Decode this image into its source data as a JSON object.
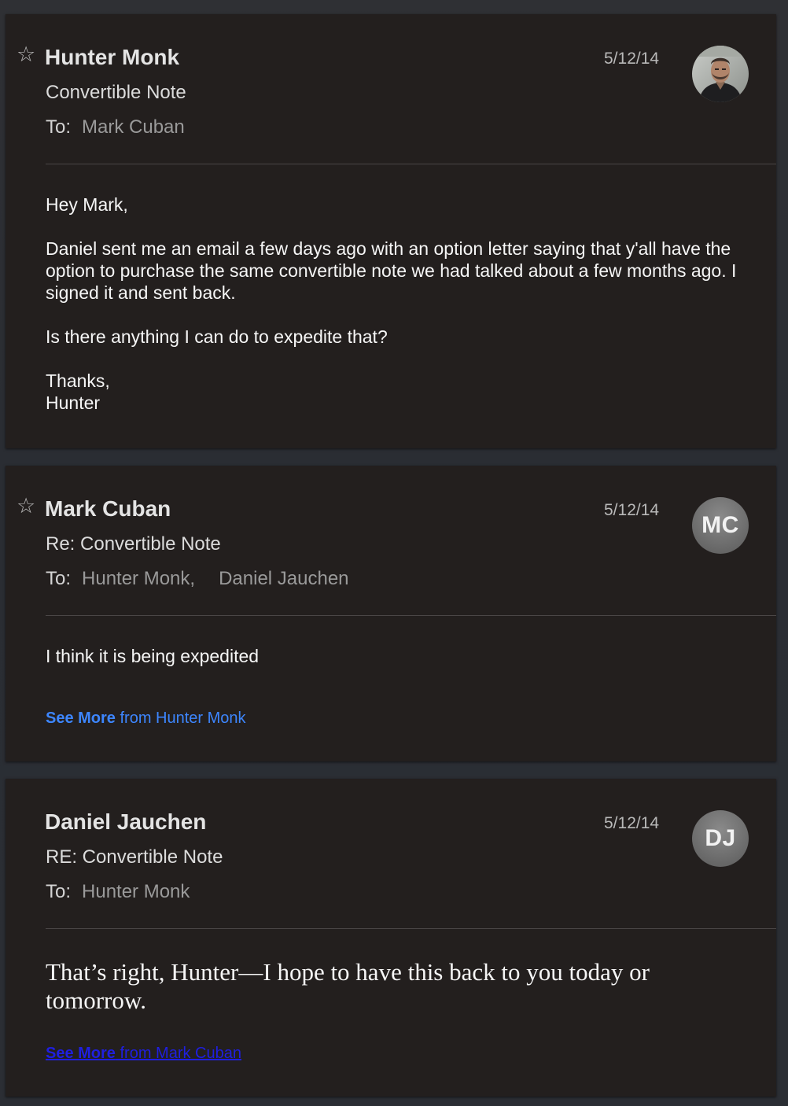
{
  "emails": [
    {
      "starred_icon": "star-outline-icon",
      "sender": "Hunter Monk",
      "date": "5/12/14",
      "subject": "Convertible Note",
      "to_label": "To:",
      "recipients": [
        "Mark Cuban"
      ],
      "avatar": "photo",
      "body_paragraphs": [
        "Hey Mark,",
        "Daniel sent me an email a few days ago with an option letter saying that y'all have the option to purchase the same convertible note we had talked about a few months ago. I signed it and sent back.",
        "Is there anything I can do to expedite that?"
      ],
      "signoff_lines": [
        "Thanks,",
        "Hunter"
      ]
    },
    {
      "starred_icon": "star-outline-icon",
      "sender": "Mark Cuban",
      "date": "5/12/14",
      "subject": "Re: Convertible Note",
      "to_label": "To:",
      "recipients": [
        "Hunter Monk,",
        "Daniel Jauchen"
      ],
      "avatar_initials": "MC",
      "body_text": "I think it is being expedited",
      "see_more_strong": "See More",
      "see_more_rest": " from Hunter Monk"
    },
    {
      "sender": "Daniel Jauchen",
      "date": "5/12/14",
      "subject": "RE: Convertible Note",
      "to_label": "To:",
      "recipients": [
        "Hunter Monk"
      ],
      "avatar_initials": "DJ",
      "body_text": "That’s right, Hunter—I hope to have this back to you today or tomorrow.",
      "see_more_strong": "See More",
      "see_more_rest": " from Mark Cuban"
    }
  ],
  "colors": {
    "card_background": "#231f1e",
    "link_blue": "#3d86ff",
    "visited_link": "#1f1fe0"
  }
}
